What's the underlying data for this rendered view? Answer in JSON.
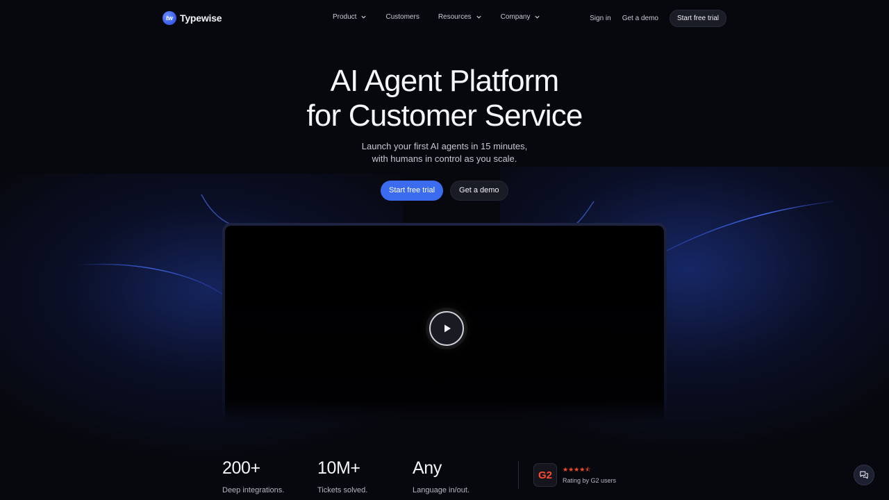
{
  "brand": {
    "name": "Typewise",
    "logo_glyph": "tw"
  },
  "nav": {
    "links": [
      {
        "label": "Product",
        "dropdown": true
      },
      {
        "label": "Customers",
        "dropdown": false
      },
      {
        "label": "Resources",
        "dropdown": true
      },
      {
        "label": "Company",
        "dropdown": true
      }
    ],
    "sign_in": "Sign in",
    "demo": "Get a demo",
    "cta": "Start free trial"
  },
  "hero": {
    "title_line1": "AI Agent Platform",
    "title_line2": "for Customer Service",
    "subtitle_line1": "Launch your first AI agents in 15 minutes,",
    "subtitle_line2": "with humans in control as you scale.",
    "primary_button": "Start free trial",
    "secondary_button": "Get a demo"
  },
  "video": {
    "play_icon": "play-icon"
  },
  "stats": [
    {
      "value": "200+",
      "label": "Deep integrations."
    },
    {
      "value": "10M+",
      "label": "Tickets solved."
    },
    {
      "value": "Any",
      "label": "Language in/out."
    }
  ],
  "g2": {
    "logo_text": "G2",
    "stars": "★★★★⯪",
    "label": "Rating by G2 users"
  },
  "colors": {
    "accent": "#3b6cf0",
    "g2_red": "#ff492c",
    "background": "#07080d"
  }
}
